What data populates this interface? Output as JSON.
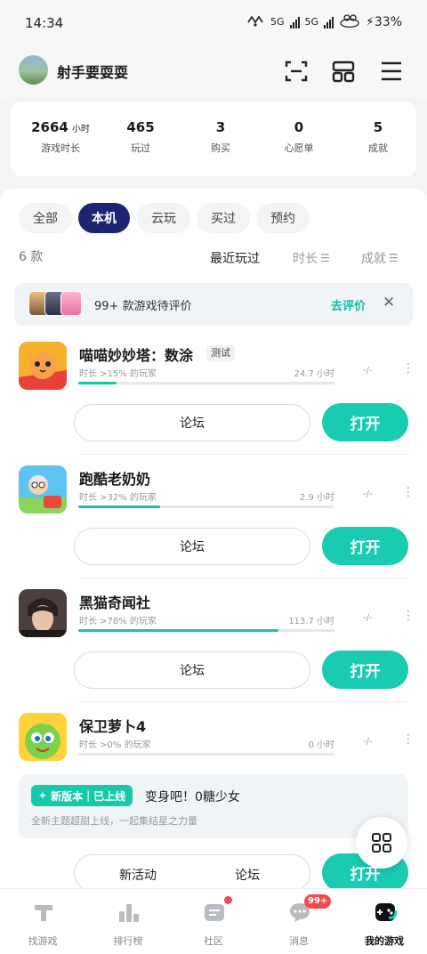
{
  "status_bar": {
    "time": "14:34",
    "network_1": "5G",
    "network_2": "5G",
    "battery": "33%"
  },
  "header": {
    "username": "射手要耍耍"
  },
  "stats": [
    {
      "value": "2664",
      "unit": "小时",
      "label": "游戏时长"
    },
    {
      "value": "465",
      "label": "玩过"
    },
    {
      "value": "3",
      "label": "购买"
    },
    {
      "value": "0",
      "label": "心愿单"
    },
    {
      "value": "5",
      "label": "成就"
    }
  ],
  "filters": [
    "全部",
    "本机",
    "云玩",
    "买过",
    "预约"
  ],
  "active_filter": "本机",
  "list": {
    "count": "6 款",
    "sort_options": [
      {
        "label": "最近玩过"
      },
      {
        "label": "时长"
      },
      {
        "label": "成就"
      }
    ]
  },
  "review_banner": {
    "text": "99+ 款游戏待评价",
    "action": "去评价"
  },
  "games": [
    {
      "title": "喵喵妙妙塔：数涂",
      "tag": "测试",
      "percentile": "时长 >15% 的玩家",
      "hours": "24.7 小时",
      "achievements": "-/-",
      "progress": 0.15,
      "forum": "论坛",
      "open": "打开"
    },
    {
      "title": "跑酷老奶奶",
      "percentile": "时长 >32% 的玩家",
      "hours": "2.9 小时",
      "achievements": "-/-",
      "progress": 0.32,
      "forum": "论坛",
      "open": "打开"
    },
    {
      "title": "黑猫奇闻社",
      "percentile": "时长 >78% 的玩家",
      "hours": "113.7 小时",
      "achievements": "-/-",
      "progress": 0.78,
      "forum": "论坛",
      "open": "打开"
    },
    {
      "title": "保卫萝卜4",
      "percentile": "时长 >0% 的玩家",
      "hours": "0 小时",
      "achievements": "-/-",
      "progress": 0.0
    }
  ],
  "news": {
    "badge": "新版本｜已上线",
    "title": "变身吧！0糖少女",
    "desc": "全新主题超甜上线，一起集结星之力量"
  },
  "last_row": {
    "activity": "新活动",
    "forum": "论坛",
    "open": "打开"
  },
  "tabbar": [
    {
      "label": "找游戏"
    },
    {
      "label": "排行榜"
    },
    {
      "label": "社区"
    },
    {
      "label": "消息",
      "badge": "99+"
    },
    {
      "label": "我的游戏"
    }
  ],
  "colors": {
    "accent": "#19cbb0",
    "active_chip": "#1c2570",
    "badge": "#f24b4b"
  }
}
